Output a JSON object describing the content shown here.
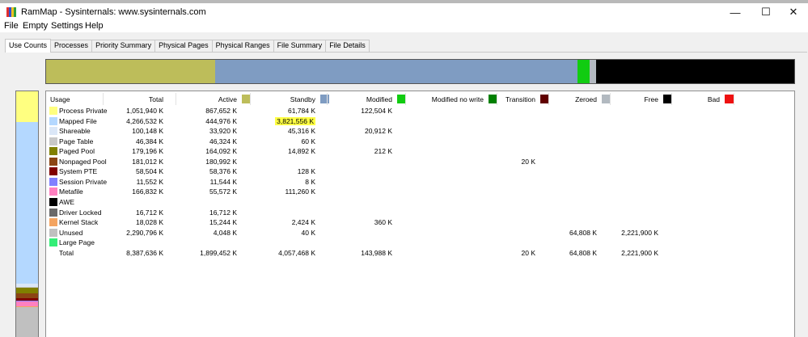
{
  "window": {
    "title": "RamMap - Sysinternals: www.sysinternals.com",
    "icon_colors": [
      "#e03030",
      "#3050d0",
      "#f0c020",
      "#30a040"
    ],
    "minimize_glyph": "—",
    "maximize_glyph": "☐",
    "close_glyph": "✕"
  },
  "menu": [
    "File",
    "Empty",
    "Settings",
    "Help"
  ],
  "tabs": {
    "items": [
      "Use Counts",
      "Processes",
      "Priority Summary",
      "Physical Pages",
      "Physical Ranges",
      "File Summary",
      "File Details"
    ],
    "selected": "Use Counts"
  },
  "summary_bar": [
    {
      "name": "Active",
      "color": "#bdbd5a",
      "fraction": 0.226
    },
    {
      "name": "Standby",
      "color": "#7f9cc2",
      "fraction": 0.484
    },
    {
      "name": "Modified",
      "color": "#11cc11",
      "fraction": 0.017
    },
    {
      "name": "Zeroed",
      "color": "#b2b9c0",
      "fraction": 0.008
    },
    {
      "name": "Free",
      "color": "#000000",
      "fraction": 0.265
    }
  ],
  "usage_bar": [
    {
      "name": "Process Private",
      "color": "#ffff80",
      "fraction": 0.125
    },
    {
      "name": "Mapped File",
      "color": "#b4d8ff",
      "fraction": 0.655
    },
    {
      "name": "Shareable",
      "color": "#dbe7f7",
      "fraction": 0.012
    },
    {
      "name": "Page Table",
      "color": "#c8c8c8",
      "fraction": 0.006
    },
    {
      "name": "Paged Pool",
      "color": "#808000",
      "fraction": 0.021
    },
    {
      "name": "Nonpaged Pool",
      "color": "#8b4513",
      "fraction": 0.022
    },
    {
      "name": "System PTE",
      "color": "#800000",
      "fraction": 0.007
    },
    {
      "name": "Session Private",
      "color": "#8080ff",
      "fraction": 0.004
    },
    {
      "name": "Metafile",
      "color": "#ff80c0",
      "fraction": 0.02
    },
    {
      "name": "Kernel Stack",
      "color": "#f4a460",
      "fraction": 0.004
    },
    {
      "name": "Unused",
      "color": "#c0c0c0",
      "fraction": 0.124
    }
  ],
  "columns": [
    {
      "label": "Usage",
      "color": null
    },
    {
      "label": "Total",
      "color": null
    },
    {
      "label": "Active",
      "color": "#bdbd5a"
    },
    {
      "label": "Standby",
      "color": "#7f9cc2"
    },
    {
      "label": "Modified",
      "color": "#11cc11"
    },
    {
      "label": "Modified no write",
      "color": "#008000"
    },
    {
      "label": "Transition",
      "color": "#600000"
    },
    {
      "label": "Zeroed",
      "color": "#b2b9c0"
    },
    {
      "label": "Free",
      "color": "#000000"
    },
    {
      "label": "Bad",
      "color": "#ee1111"
    }
  ],
  "rows": [
    {
      "usage": "Process Private",
      "color": "#ffff80",
      "total": "1,051,940 K",
      "active": "867,652 K",
      "standby": "61,784 K",
      "modified": "122,504 K",
      "modified_no_write": "",
      "transition": "",
      "zeroed": "",
      "free": "",
      "bad": ""
    },
    {
      "usage": "Mapped File",
      "color": "#b4d8ff",
      "total": "4,266,532 K",
      "active": "444,976 K",
      "standby": "3,821,556 K",
      "standby_highlighted": true,
      "modified": "",
      "modified_no_write": "",
      "transition": "",
      "zeroed": "",
      "free": "",
      "bad": ""
    },
    {
      "usage": "Shareable",
      "color": "#dbe7f7",
      "total": "100,148 K",
      "active": "33,920 K",
      "standby": "45,316 K",
      "modified": "20,912 K",
      "modified_no_write": "",
      "transition": "",
      "zeroed": "",
      "free": "",
      "bad": ""
    },
    {
      "usage": "Page Table",
      "color": "#c8c8c8",
      "total": "46,384 K",
      "active": "46,324 K",
      "standby": "60 K",
      "modified": "",
      "modified_no_write": "",
      "transition": "",
      "zeroed": "",
      "free": "",
      "bad": ""
    },
    {
      "usage": "Paged Pool",
      "color": "#808000",
      "total": "179,196 K",
      "active": "164,092 K",
      "standby": "14,892 K",
      "modified": "212 K",
      "modified_no_write": "",
      "transition": "",
      "zeroed": "",
      "free": "",
      "bad": ""
    },
    {
      "usage": "Nonpaged Pool",
      "color": "#8b4513",
      "total": "181,012 K",
      "active": "180,992 K",
      "standby": "",
      "modified": "",
      "modified_no_write": "",
      "transition": "20 K",
      "zeroed": "",
      "free": "",
      "bad": ""
    },
    {
      "usage": "System PTE",
      "color": "#800000",
      "total": "58,504 K",
      "active": "58,376 K",
      "standby": "128 K",
      "modified": "",
      "modified_no_write": "",
      "transition": "",
      "zeroed": "",
      "free": "",
      "bad": ""
    },
    {
      "usage": "Session Private",
      "color": "#8080ff",
      "total": "11,552 K",
      "active": "11,544 K",
      "standby": "8 K",
      "modified": "",
      "modified_no_write": "",
      "transition": "",
      "zeroed": "",
      "free": "",
      "bad": ""
    },
    {
      "usage": "Metafile",
      "color": "#ff80c0",
      "total": "166,832 K",
      "active": "55,572 K",
      "standby": "111,260 K",
      "modified": "",
      "modified_no_write": "",
      "transition": "",
      "zeroed": "",
      "free": "",
      "bad": ""
    },
    {
      "usage": "AWE",
      "color": "#000000",
      "total": "",
      "active": "",
      "standby": "",
      "modified": "",
      "modified_no_write": "",
      "transition": "",
      "zeroed": "",
      "free": "",
      "bad": ""
    },
    {
      "usage": "Driver Locked",
      "color": "#696969",
      "total": "16,712 K",
      "active": "16,712 K",
      "standby": "",
      "modified": "",
      "modified_no_write": "",
      "transition": "",
      "zeroed": "",
      "free": "",
      "bad": ""
    },
    {
      "usage": "Kernel Stack",
      "color": "#f4a460",
      "total": "18,028 K",
      "active": "15,244 K",
      "standby": "2,424 K",
      "modified": "360 K",
      "modified_no_write": "",
      "transition": "",
      "zeroed": "",
      "free": "",
      "bad": ""
    },
    {
      "usage": "Unused",
      "color": "#c0c0c0",
      "total": "2,290,796 K",
      "active": "4,048 K",
      "standby": "40 K",
      "modified": "",
      "modified_no_write": "",
      "transition": "",
      "zeroed": "64,808 K",
      "free": "2,221,900 K",
      "bad": ""
    },
    {
      "usage": "Large Page",
      "color": "#33ee77",
      "total": "",
      "active": "",
      "standby": "",
      "modified": "",
      "modified_no_write": "",
      "transition": "",
      "zeroed": "",
      "free": "",
      "bad": ""
    },
    {
      "usage": "Total",
      "color": null,
      "total": "8,387,636 K",
      "active": "1,899,452 K",
      "standby": "4,057,468 K",
      "modified": "143,988 K",
      "modified_no_write": "",
      "transition": "20 K",
      "zeroed": "64,808 K",
      "free": "2,221,900 K",
      "bad": ""
    }
  ],
  "highlight_color": "#ffff44"
}
